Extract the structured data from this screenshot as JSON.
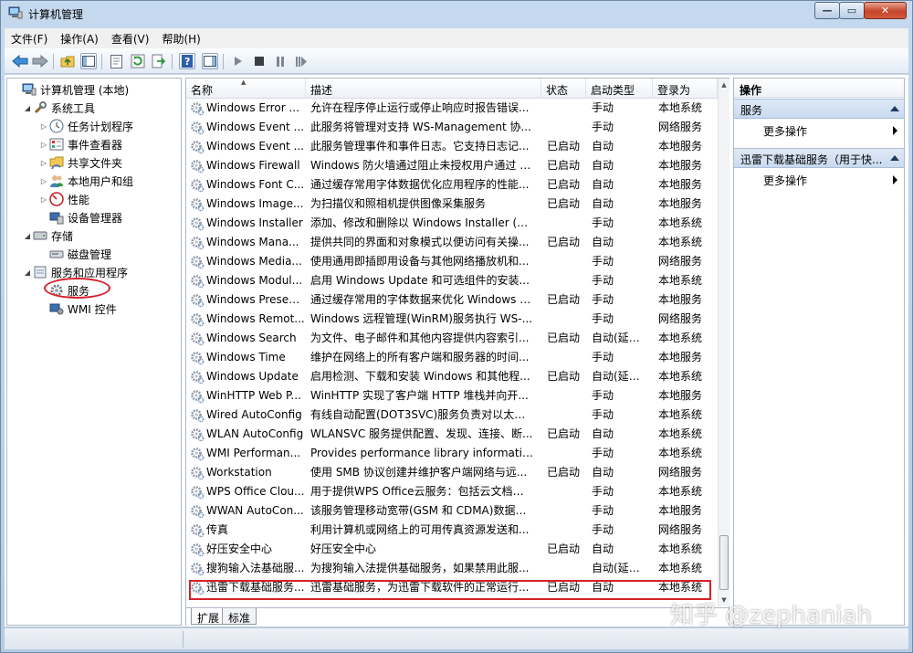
{
  "window": {
    "title": "计算机管理"
  },
  "menu": [
    "文件(F)",
    "操作(A)",
    "查看(V)",
    "帮助(H)"
  ],
  "tree": [
    {
      "label": "计算机管理 (本地)",
      "level": 0,
      "twisty": "",
      "icon": "computer-icon"
    },
    {
      "label": "系统工具",
      "level": 1,
      "twisty": "◢",
      "icon": "tools-icon"
    },
    {
      "label": "任务计划程序",
      "level": 2,
      "twisty": "▷",
      "icon": "clock-icon"
    },
    {
      "label": "事件查看器",
      "level": 2,
      "twisty": "▷",
      "icon": "event-viewer-icon"
    },
    {
      "label": "共享文件夹",
      "level": 2,
      "twisty": "▷",
      "icon": "shared-folder-icon"
    },
    {
      "label": "本地用户和组",
      "level": 2,
      "twisty": "▷",
      "icon": "users-icon"
    },
    {
      "label": "性能",
      "level": 2,
      "twisty": "▷",
      "icon": "performance-icon"
    },
    {
      "label": "设备管理器",
      "level": 2,
      "twisty": "",
      "icon": "device-manager-icon"
    },
    {
      "label": "存储",
      "level": 1,
      "twisty": "◢",
      "icon": "storage-icon"
    },
    {
      "label": "磁盘管理",
      "level": 2,
      "twisty": "",
      "icon": "disk-icon"
    },
    {
      "label": "服务和应用程序",
      "level": 1,
      "twisty": "◢",
      "icon": "services-apps-icon"
    },
    {
      "label": "服务",
      "level": 2,
      "twisty": "",
      "icon": "gear-icon"
    },
    {
      "label": "WMI 控件",
      "level": 2,
      "twisty": "",
      "icon": "wmi-icon"
    }
  ],
  "columns": {
    "name": "名称",
    "desc": "描述",
    "status": "状态",
    "startup": "启动类型",
    "logon": "登录为"
  },
  "services": [
    {
      "name": "Windows Error ...",
      "desc": "允许在程序停止运行或停止响应时报告错误...",
      "status": "",
      "startup": "手动",
      "logon": "本地系统"
    },
    {
      "name": "Windows Event ...",
      "desc": "此服务将管理对支持 WS-Management 协...",
      "status": "",
      "startup": "手动",
      "logon": "网络服务"
    },
    {
      "name": "Windows Event ...",
      "desc": "此服务管理事件和事件日志。它支持日志记...",
      "status": "已启动",
      "startup": "自动",
      "logon": "本地服务"
    },
    {
      "name": "Windows Firewall",
      "desc": "Windows 防火墙通过阻止未授权用户通过 I...",
      "status": "已启动",
      "startup": "自动",
      "logon": "本地服务"
    },
    {
      "name": "Windows Font C...",
      "desc": "通过缓存常用字体数据优化应用程序的性能...",
      "status": "已启动",
      "startup": "自动",
      "logon": "本地服务"
    },
    {
      "name": "Windows Image...",
      "desc": "为扫描仪和照相机提供图像采集服务",
      "status": "已启动",
      "startup": "自动",
      "logon": "本地服务"
    },
    {
      "name": "Windows Installer",
      "desc": "添加、修改和删除以 Windows Installer (*....",
      "status": "",
      "startup": "手动",
      "logon": "本地系统"
    },
    {
      "name": "Windows Mana...",
      "desc": "提供共同的界面和对象模式以便访问有关操...",
      "status": "已启动",
      "startup": "自动",
      "logon": "本地系统"
    },
    {
      "name": "Windows Media...",
      "desc": "使用通用即插即用设备与其他网络播放机和...",
      "status": "",
      "startup": "手动",
      "logon": "网络服务"
    },
    {
      "name": "Windows Modul...",
      "desc": "启用 Windows Update 和可选组件的安装...",
      "status": "",
      "startup": "手动",
      "logon": "本地系统"
    },
    {
      "name": "Windows Presen...",
      "desc": "通过缓存常用的字体数据来优化 Windows P...",
      "status": "已启动",
      "startup": "手动",
      "logon": "本地服务"
    },
    {
      "name": "Windows Remot...",
      "desc": "Windows 远程管理(WinRM)服务执行 WS-...",
      "status": "",
      "startup": "手动",
      "logon": "网络服务"
    },
    {
      "name": "Windows Search",
      "desc": "为文件、电子邮件和其他内容提供内容索引...",
      "status": "已启动",
      "startup": "自动(延迟...",
      "logon": "本地系统"
    },
    {
      "name": "Windows Time",
      "desc": "维护在网络上的所有客户端和服务器的时间...",
      "status": "",
      "startup": "手动",
      "logon": "本地服务"
    },
    {
      "name": "Windows Update",
      "desc": "启用检测、下载和安装 Windows 和其他程...",
      "status": "已启动",
      "startup": "自动(延迟...",
      "logon": "本地系统"
    },
    {
      "name": "WinHTTP Web P...",
      "desc": "WinHTTP 实现了客户端 HTTP 堆栈并向开...",
      "status": "",
      "startup": "手动",
      "logon": "本地服务"
    },
    {
      "name": "Wired AutoConfig",
      "desc": "有线自动配置(DOT3SVC)服务负责对以太网...",
      "status": "",
      "startup": "手动",
      "logon": "本地系统"
    },
    {
      "name": "WLAN AutoConfig",
      "desc": "WLANSVC 服务提供配置、发现、连接、断...",
      "status": "已启动",
      "startup": "自动",
      "logon": "本地系统"
    },
    {
      "name": "WMI Performan...",
      "desc": "Provides performance library informatio...",
      "status": "",
      "startup": "手动",
      "logon": "本地系统"
    },
    {
      "name": "Workstation",
      "desc": "使用 SMB 协议创建并维护客户端网络与远...",
      "status": "已启动",
      "startup": "自动",
      "logon": "网络服务"
    },
    {
      "name": "WPS Office Clou...",
      "desc": "用于提供WPS Office云服务：包括云文档、...",
      "status": "",
      "startup": "手动",
      "logon": "本地系统"
    },
    {
      "name": "WWAN AutoCon...",
      "desc": "该服务管理移动宽带(GSM 和 CDMA)数据卡...",
      "status": "",
      "startup": "手动",
      "logon": "本地服务"
    },
    {
      "name": "传真",
      "desc": "利用计算机或网络上的可用传真资源发送和...",
      "status": "",
      "startup": "手动",
      "logon": "网络服务"
    },
    {
      "name": "好压安全中心",
      "desc": "好压安全中心",
      "status": "已启动",
      "startup": "自动",
      "logon": "本地系统"
    },
    {
      "name": "搜狗输入法基础服...",
      "desc": "为搜狗输入法提供基础服务，如果禁用此服...",
      "status": "",
      "startup": "自动(延迟...",
      "logon": "本地系统"
    },
    {
      "name": "迅雷下载基础服务...",
      "desc": "迅雷基础服务，为迅雷下载软件的正常运行...",
      "status": "已启动",
      "startup": "自动",
      "logon": "本地系统"
    }
  ],
  "tabs": [
    "扩展",
    "标准"
  ],
  "actions": {
    "title": "操作",
    "sections": [
      {
        "label": "服务",
        "item": "更多操作"
      },
      {
        "label": "迅雷下载基础服务（用于快...",
        "item": "更多操作"
      }
    ]
  },
  "watermark": "知乎 @zephaniah"
}
